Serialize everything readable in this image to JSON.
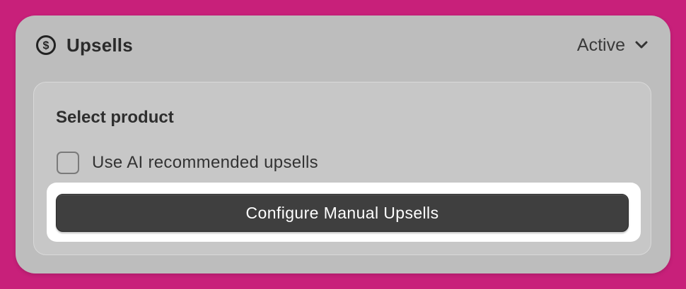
{
  "card": {
    "title": "Upsells",
    "title_icon": "dollar-circle-icon",
    "status": "Active",
    "status_icon": "chevron-down-icon"
  },
  "panel": {
    "title": "Select product",
    "checkbox": {
      "label": "Use AI recommended upsells",
      "checked": false
    },
    "configure_button_label": "Configure Manual Upsells"
  },
  "colors": {
    "page_background": "#c8207a",
    "card_background": "#bdbdbd",
    "panel_background": "#c7c7c7",
    "button_background": "#3f3f3f",
    "highlight": "#ffffff"
  }
}
